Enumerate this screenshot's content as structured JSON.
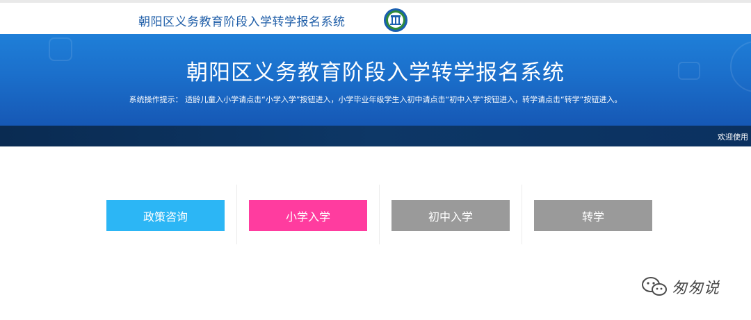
{
  "header": {
    "title": "朝阳区义务教育阶段入学转学报名系统"
  },
  "banner": {
    "title": "朝阳区义务教育阶段入学转学报名系统",
    "hint": "系统操作提示：  适龄儿童入小学请点击“小学入学”按钮进入，小学毕业年级学生入初中请点击“初中入学”按钮进入，转学请点击“转学”按钮进入。"
  },
  "status_bar": {
    "marquee": "欢迎使用"
  },
  "menu": {
    "buttons": [
      {
        "label": "政策咨询",
        "color": "#2cb6f5"
      },
      {
        "label": "小学入学",
        "color": "#ff3c9f"
      },
      {
        "label": "初中入学",
        "color": "#9a9a9a"
      },
      {
        "label": "转学",
        "color": "#9a9a9a"
      }
    ]
  },
  "watermark": {
    "text": "匆匆说",
    "icon": "wechat-icon"
  },
  "colors": {
    "header_title": "#1f5ea8",
    "banner_top": "#1f7fd8",
    "banner_bottom": "#1658b5",
    "status_bar": "#0b3160"
  }
}
